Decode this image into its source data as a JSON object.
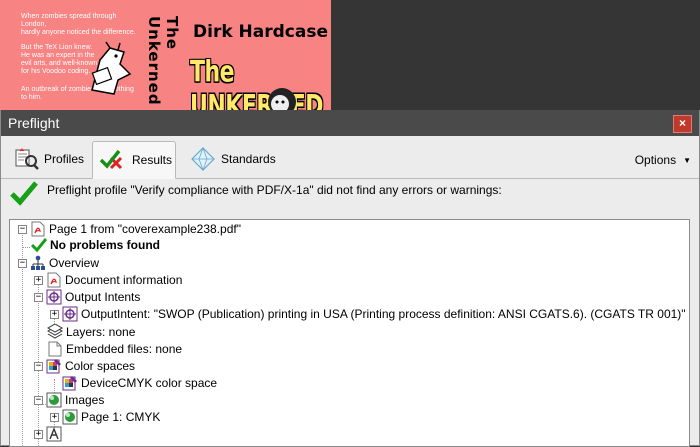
{
  "cover": {
    "blurb_lines": [
      "When zombies spread through London,\nhardly anyone noticed the difference.",
      "But the TeX Lion knew.\nHe was an expert in the\nevil arts, and well-known\nfor his Voodoo coding.",
      "An outbreak of zombies was nothing to him."
    ],
    "spine_text": "The Unkerned",
    "author": "Dirk Hardcase",
    "book_title": "The UNKERNED",
    "colors": {
      "background": "#f78383",
      "title": "#ffe86a"
    }
  },
  "window": {
    "title": "Preflight",
    "close_label": "×",
    "tabs": [
      {
        "label": "Profiles",
        "icon": "profiles-icon",
        "active": false
      },
      {
        "label": "Results",
        "icon": "results-checkmark-icon",
        "active": true
      },
      {
        "label": "Standards",
        "icon": "standards-diamond-icon",
        "active": false
      }
    ],
    "options_label": "Options",
    "result_message": "Preflight profile \"Verify compliance with PDF/X-1a\" did not find any errors or warnings:"
  },
  "tree": [
    {
      "label": "Page 1 from \"coverexample238.pdf\"",
      "icon": "pdf-document-icon",
      "expander": "minus"
    },
    {
      "label": "No problems found",
      "icon": "green-check-icon",
      "bold": true
    },
    {
      "label": "Overview",
      "icon": "overview-hierarchy-icon",
      "expander": "minus"
    },
    {
      "label": "Document information",
      "icon": "pdf-icon",
      "expander": "plus"
    },
    {
      "label": "Output Intents",
      "icon": "output-intents-icon",
      "expander": "minus"
    },
    {
      "label": "OutputIntent: \"SWOP (Publication) printing in USA (Printing process definition: ANSI CGATS.6). (CGATS TR 001)\"",
      "icon": "output-intent-icon",
      "expander": "plus"
    },
    {
      "label": "Layers: none",
      "icon": "layers-icon"
    },
    {
      "label": "Embedded files: none",
      "icon": "embedded-file-icon"
    },
    {
      "label": "Color spaces",
      "icon": "color-spaces-icon",
      "expander": "minus"
    },
    {
      "label": "DeviceCMYK color space",
      "icon": "cmyk-color-icon"
    },
    {
      "label": "Images",
      "icon": "images-icon",
      "expander": "minus"
    },
    {
      "label": "Page 1: CMYK",
      "icon": "image-icon",
      "expander": "plus"
    },
    {
      "label": "",
      "icon": "fonts-icon",
      "expander": "plus"
    }
  ]
}
